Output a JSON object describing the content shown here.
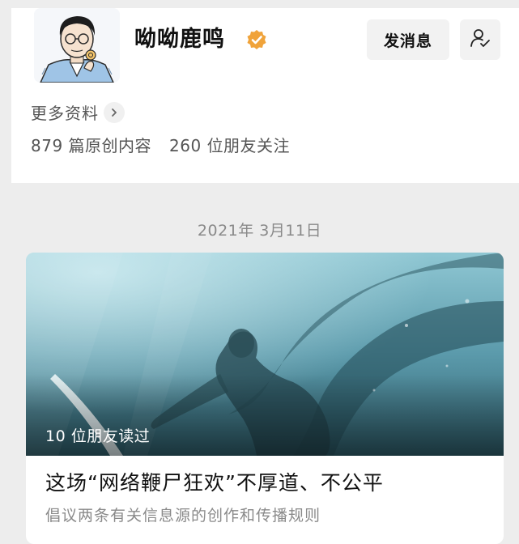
{
  "profile": {
    "name": "呦呦鹿鸣",
    "message_button": "发消息",
    "more_info": "更多资料",
    "original_count": "879 篇原创内容",
    "friends_following": "260 位朋友关注",
    "verified_color": "#f0a33a",
    "icons": {
      "verified": "verified-badge-icon",
      "follow": "user-check-icon",
      "more": "chevron-right-icon"
    }
  },
  "feed": {
    "date": "2021年 3月11日",
    "article": {
      "read_by": "10 位朋友读过",
      "title": "这场“网络鞭尸狂欢”不厚道、不公平",
      "subtitle": "倡议两条有关信息源的创作和传播规则"
    }
  }
}
